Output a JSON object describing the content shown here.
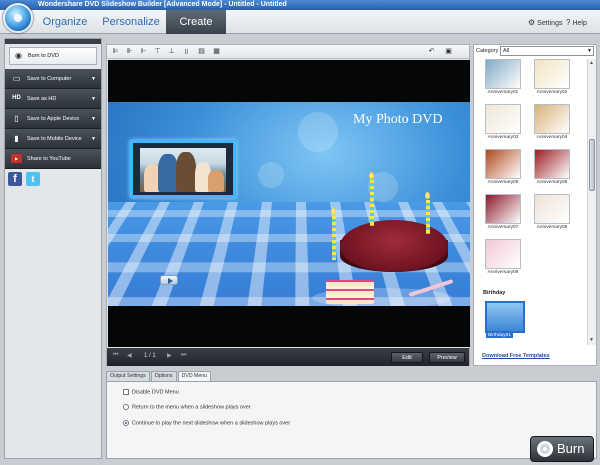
{
  "window": {
    "title": "Wondershare DVD Slideshow Builder [Advanced Mode] - Untitled - Untitled"
  },
  "main_tabs": [
    {
      "label": "Organize",
      "active": false
    },
    {
      "label": "Personalize",
      "active": false
    },
    {
      "label": "Create",
      "active": true
    }
  ],
  "header_links": {
    "settings": "Settings",
    "help": "Help"
  },
  "left_panel": {
    "items": [
      {
        "label": "Burn to DVD",
        "icon": "disc-icon",
        "active": true,
        "has_arrow": false
      },
      {
        "label": "Save to Computer",
        "icon": "monitor-icon",
        "active": false,
        "has_arrow": true
      },
      {
        "label": "Save as HD",
        "icon": "hd-icon",
        "active": false,
        "has_arrow": true
      },
      {
        "label": "Save to Apple Device",
        "icon": "apple-device-icon",
        "active": false,
        "has_arrow": true
      },
      {
        "label": "Save to Mobile Device",
        "icon": "mobile-icon",
        "active": false,
        "has_arrow": true
      },
      {
        "label": "Share to YouTube",
        "icon": "youtube-icon",
        "active": false,
        "has_arrow": false
      }
    ],
    "social": {
      "facebook": "f",
      "twitter": "t"
    }
  },
  "preview": {
    "dvd_title": "My Photo DVD",
    "page_indicator": "1 / 1",
    "edit_label": "Edit",
    "preview_label": "Preview"
  },
  "templates": {
    "category_label": "Category",
    "category_value": "All",
    "anniversary": [
      {
        "label": "Anniversary01",
        "color": "#7fa9c4"
      },
      {
        "label": "Anniversary02",
        "color": "#f3e3c2"
      },
      {
        "label": "Anniversary03",
        "color": "#efe7d6"
      },
      {
        "label": "Anniversary04",
        "color": "#d9b17a"
      },
      {
        "label": "Anniversary05",
        "color": "#b0481e"
      },
      {
        "label": "Anniversary06",
        "color": "#9e1a22"
      },
      {
        "label": "Anniversary07",
        "color": "#8a1a2a"
      },
      {
        "label": "Anniversary08",
        "color": "#eee2d6"
      },
      {
        "label": "Anniversary09",
        "color": "#f2c7d6"
      }
    ],
    "birthday_group": "Birthday",
    "birthday_selected": "Birthday01",
    "download_link": "Download Free Templates"
  },
  "bottom_tabs": [
    {
      "label": "Output Settings",
      "active": false
    },
    {
      "label": "Options",
      "active": false
    },
    {
      "label": "DVD Menu",
      "active": true
    }
  ],
  "dvd_menu_options": {
    "disable_menu": "Disable DVD Menu",
    "return_to_menu": "Return to the menu when a slideshow plays over",
    "continue_next": "Continue to play the next slideshow when a slideshow plays over"
  },
  "burn_button": {
    "label": "Burn"
  },
  "colors": {
    "accent": "#2c6db0",
    "dark_panel": "#2d3238",
    "selection": "#2a6fd0"
  }
}
